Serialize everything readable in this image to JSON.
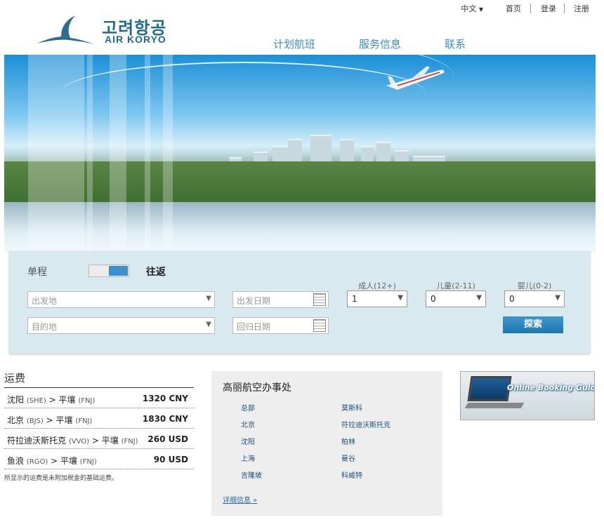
{
  "util_nav": {
    "language": "中文",
    "home": "首页",
    "login": "登录",
    "register": "注册"
  },
  "logo": {
    "korean": "고려항공",
    "english": "AIR KORYO"
  },
  "main_nav": {
    "schedule": "计划航班",
    "service": "服务信息",
    "contact": "联系"
  },
  "booking": {
    "one_way": "单程",
    "round_trip": "往返",
    "origin_placeholder": "出发地",
    "destination_placeholder": "目的地",
    "depart_date_placeholder": "出发日期",
    "return_date_placeholder": "回归日期",
    "adults_label": "成人(12+)",
    "adults_value": "1",
    "children_label": "儿童(2-11)",
    "children_value": "0",
    "infants_label": "婴儿(0-2)",
    "infants_value": "0",
    "search_button": "探索"
  },
  "fares": {
    "title": "运费",
    "rows": [
      {
        "from": "沈阳",
        "from_code": "(SHE)",
        "to": "平壤",
        "to_code": "(FNJ)",
        "price": "1320 CNY"
      },
      {
        "from": "北京",
        "from_code": "(BJS)",
        "to": "平壤",
        "to_code": "(FNJ)",
        "price": "1830 CNY"
      },
      {
        "from": "符拉迪沃斯托克",
        "from_code": "(VVO)",
        "to": "平壤",
        "to_code": "(FNJ)",
        "price": "260 USD"
      },
      {
        "from": "鱼浪",
        "from_code": "(RGO)",
        "to": "平壤",
        "to_code": "(FNJ)",
        "price": "90 USD"
      }
    ],
    "note": "所显示的运费是未附加税金的基础运费。"
  },
  "offices": {
    "title": "高丽航空办事处",
    "left": [
      "总部",
      "北京",
      "沈阳",
      "上海",
      "吉隆坡"
    ],
    "right": [
      "莫斯科",
      "符拉迪沃斯托克",
      "柏林",
      "曼谷",
      "科威特"
    ],
    "more": "详细信息 »"
  },
  "guide": {
    "text": "Online Booking Guide"
  },
  "colors": {
    "accent": "#3a8fb5",
    "button": "#1f77ad",
    "panel": "#d8e9f0"
  }
}
